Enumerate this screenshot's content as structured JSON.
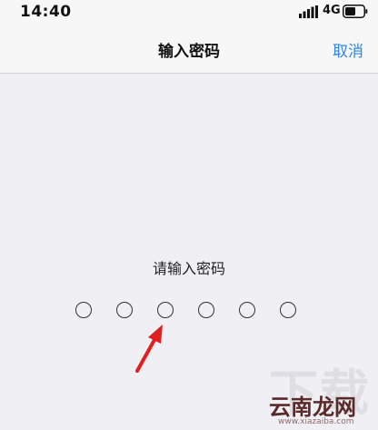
{
  "status_bar": {
    "time": "14:40",
    "network": "4G",
    "icons": [
      "signal-icon",
      "battery-icon"
    ]
  },
  "nav": {
    "title": "输入密码",
    "cancel_label": "取消",
    "accent_color": "#2f86e8"
  },
  "passcode": {
    "prompt": "请输入密码",
    "digits_total": 6,
    "digits_entered": 0
  },
  "watermark": {
    "logo_text": "云南龙网",
    "url_text": "www.xiazaiba.com"
  }
}
